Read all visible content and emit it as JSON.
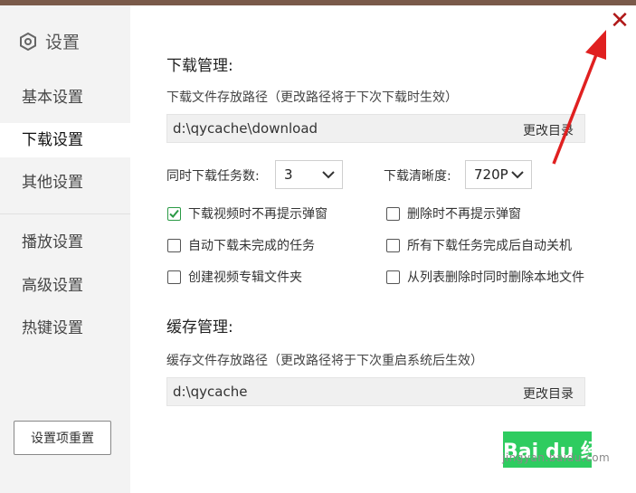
{
  "sidebar": {
    "title": "设置",
    "items": [
      {
        "label": "基本设置",
        "active": false
      },
      {
        "label": "下载设置",
        "active": true
      },
      {
        "label": "其他设置",
        "active": false
      },
      {
        "label": "播放设置",
        "active": false
      },
      {
        "label": "高级设置",
        "active": false
      },
      {
        "label": "热键设置",
        "active": false
      }
    ],
    "reset_label": "设置项重置"
  },
  "download": {
    "section_title": "下载管理:",
    "path_hint": "下载文件存放路径（更改路径将于下次下载时生效）",
    "path_value": "d:\\qycache\\download",
    "change_dir_label": "更改目录",
    "concurrent_label": "同时下载任务数:",
    "concurrent_value": "3",
    "quality_label": "下载清晰度:",
    "quality_value": "720P",
    "options": [
      {
        "label": "下载视频时不再提示弹窗",
        "checked": true
      },
      {
        "label": "删除时不再提示弹窗",
        "checked": false
      },
      {
        "label": "自动下载未完成的任务",
        "checked": false
      },
      {
        "label": "所有下载任务完成后自动关机",
        "checked": false
      },
      {
        "label": "创建视频专辑文件夹",
        "checked": false
      },
      {
        "label": "从列表删除时同时删除本地文件",
        "checked": false
      }
    ]
  },
  "cache": {
    "section_title": "缓存管理:",
    "path_hint": "缓存文件存放路径（更改路径将于下次重启系统后生效）",
    "path_value": "d:\\qycache",
    "change_dir_label": "更改目录"
  },
  "window": {
    "close_icon": "close-icon"
  },
  "annotation": {
    "arrow_color": "#e02020"
  },
  "watermark": {
    "brand": "Bai du 经验",
    "site": "jingyan.baidu.com"
  },
  "colors": {
    "accent_green": "#2a9a45",
    "close_red": "#b01818",
    "sidebar_bg": "#f3f3f3"
  }
}
